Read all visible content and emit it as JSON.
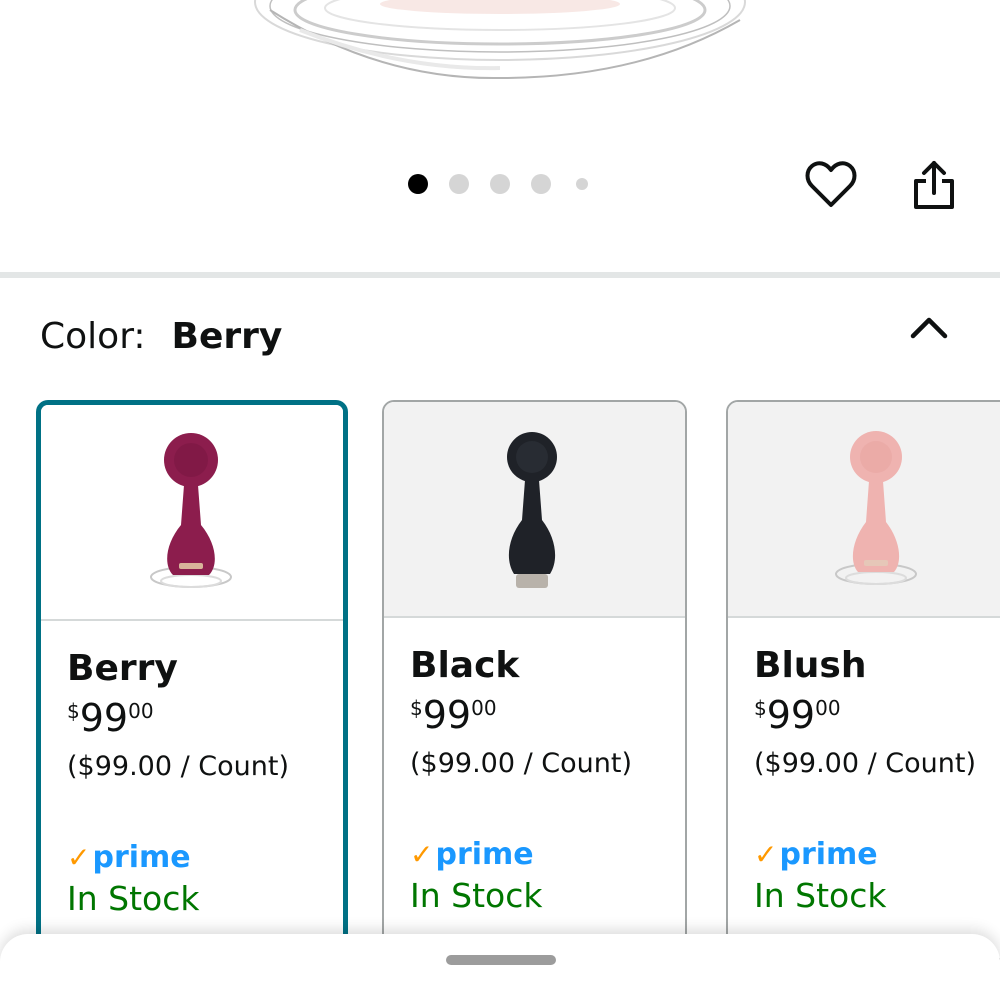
{
  "carousel": {
    "dot_count": 5,
    "active_index": 0
  },
  "actions": {
    "heart_icon": "heart-outline-icon",
    "share_icon": "share-icon"
  },
  "color_selector": {
    "label": "Color:",
    "selected": "Berry",
    "collapse_icon": "chevron-up-icon"
  },
  "swatches": [
    {
      "name": "Berry",
      "price_symbol": "$",
      "price_whole": "99",
      "price_fraction": "00",
      "unit_price": "($99.00 / Count)",
      "prime": "prime",
      "stock": "In Stock",
      "selected": true,
      "product_color": "#8c1d4d"
    },
    {
      "name": "Black",
      "price_symbol": "$",
      "price_whole": "99",
      "price_fraction": "00",
      "unit_price": "($99.00 / Count)",
      "prime": "prime",
      "stock": "In Stock",
      "selected": false,
      "product_color": "#1f2228"
    },
    {
      "name": "Blush",
      "price_symbol": "$",
      "price_whole": "99",
      "price_fraction": "00",
      "unit_price": "($99.00 / Count)",
      "prime": "prime",
      "stock": "In Stock",
      "selected": false,
      "product_color": "#efb3b0"
    }
  ],
  "colors": {
    "selected_border": "#007185",
    "prime_blue": "#1a98ff",
    "prime_check": "#ff9900",
    "in_stock_green": "#007600"
  }
}
